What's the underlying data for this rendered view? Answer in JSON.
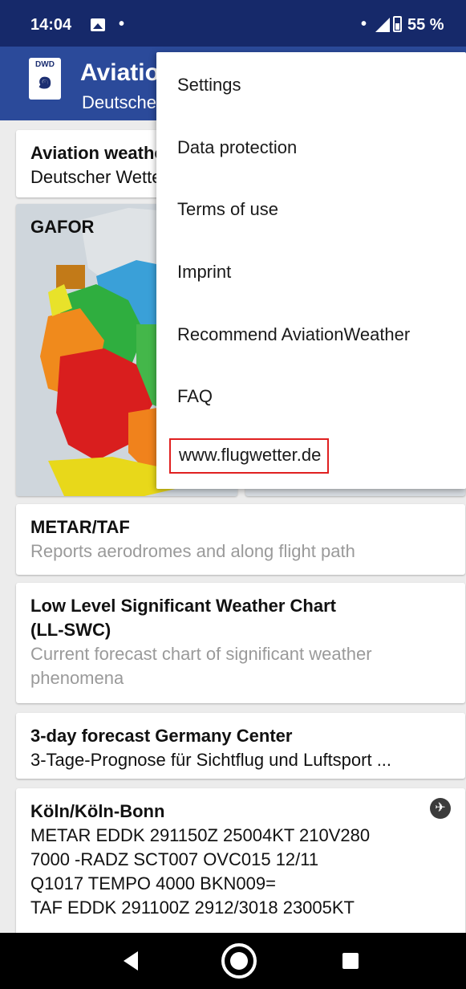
{
  "status_bar": {
    "time": "14:04",
    "dot_left": "•",
    "dot_right": "•",
    "battery": "55 %"
  },
  "app_bar": {
    "logo_text": "DWD",
    "title": "AviationWeather",
    "subtitle": "Deutscher Wetterdienst"
  },
  "cards": {
    "aviation": {
      "title": "Aviation weather",
      "subtitle": "Deutscher Wetterdienst"
    },
    "gafor": {
      "label": "GAFOR"
    },
    "metar": {
      "title": "METAR/TAF",
      "subtitle": "Reports aerodromes and along flight path"
    },
    "llswc": {
      "title_line1": "Low Level Significant Weather Chart",
      "title_line2": "(LL-SWC)",
      "desc_line1": "Current forecast chart of significant weather",
      "desc_line2": "phenomena"
    },
    "forecast": {
      "title": "3-day forecast Germany Center",
      "subtitle": "3-Tage-Prognose für Sichtflug und Luftsport ..."
    },
    "airport": {
      "title": "Köln/Köln-Bonn",
      "line1": "METAR EDDK 291150Z 25004KT 210V280",
      "line2": "7000 -RADZ SCT007 OVC015 12/11",
      "line3": "Q1017 TEMPO 4000 BKN009=",
      "line4": "TAF EDDK 291100Z 2912/3018 23005KT"
    }
  },
  "menu": {
    "items": [
      "Settings",
      "Data protection",
      "Terms of use",
      "Imprint",
      "Recommend AviationWeather",
      "FAQ",
      "www.flugwetter.de"
    ]
  },
  "colors": {
    "status_bar": "#16296a",
    "app_bar": "#2b4a9a",
    "highlight_border": "#e02020"
  },
  "icons": {
    "status_image": "image-icon",
    "signal": "signal-icon",
    "battery": "battery-icon",
    "airport": "airplane-icon",
    "nav_back": "back-icon",
    "nav_home": "home-icon",
    "nav_recent": "recents-icon"
  }
}
